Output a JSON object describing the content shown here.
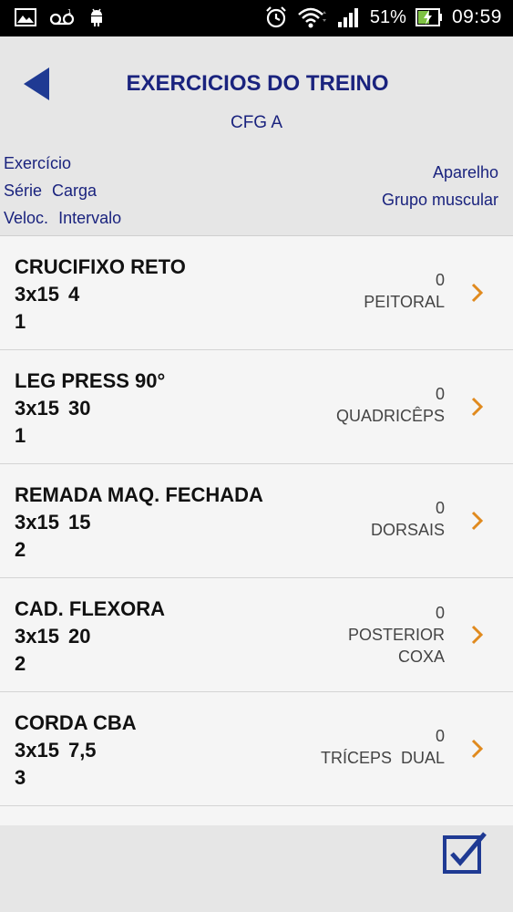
{
  "status_bar": {
    "battery_percent": "51%",
    "time": "09:59"
  },
  "header": {
    "title": "EXERCICIOS DO TREINO",
    "subtitle": "CFG A",
    "legend_left": {
      "line1": "Exercício",
      "serie": "Série",
      "carga": "Carga",
      "veloc": "Veloc.",
      "intervalo": "Intervalo"
    },
    "legend_right": {
      "aparelho": "Aparelho",
      "grupo_muscular": "Grupo muscular"
    }
  },
  "exercises": [
    {
      "name": "CRUCIFIXO RETO",
      "serie": "3x15",
      "carga": "4",
      "veloc": "1",
      "aparelho": "0",
      "grupo": "PEITORAL",
      "grupo2": ""
    },
    {
      "name": "LEG PRESS 90°",
      "serie": "3x15",
      "carga": "30",
      "veloc": "1",
      "aparelho": "0",
      "grupo": "QUADRICÊPS",
      "grupo2": ""
    },
    {
      "name": "REMADA MAQ. FECHADA",
      "serie": "3x15",
      "carga": "15",
      "veloc": "2",
      "aparelho": "0",
      "grupo": "DORSAIS",
      "grupo2": ""
    },
    {
      "name": "CAD. FLEXORA",
      "serie": "3x15",
      "carga": "20",
      "veloc": "2",
      "aparelho": "0",
      "grupo": "POSTERIOR",
      "grupo2": "COXA"
    },
    {
      "name": "CORDA CBA",
      "serie": "3x15",
      "carga": "7,5",
      "veloc": "3",
      "aparelho": "0",
      "grupo": "TRÍCEPS  DUAL",
      "grupo2": ""
    }
  ],
  "colors": {
    "accent_navy": "#1a237e",
    "chevron_orange": "#e08a1e",
    "back_arrow": "#1f3a93"
  },
  "icons": [
    "gallery-icon",
    "voicemail-icon",
    "android-icon",
    "alarm-icon",
    "wifi-icon",
    "signal-icon",
    "battery-charging-icon",
    "back-arrow-icon",
    "chevron-right-icon",
    "checkbox-checked-icon"
  ]
}
